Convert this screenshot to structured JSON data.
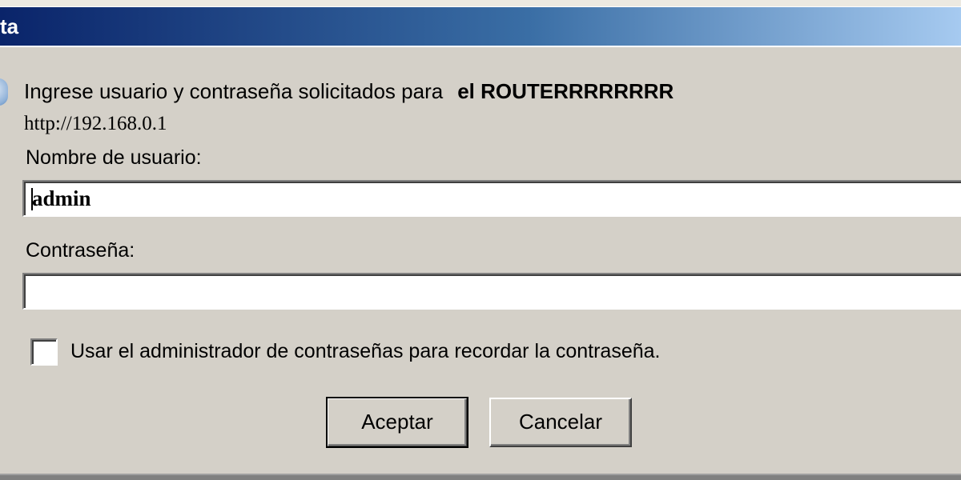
{
  "window": {
    "title": "ta"
  },
  "prompt": {
    "text": "Ingrese usuario y contraseña solicitados para",
    "realm": "el ROUTERRRRRRRR",
    "url": "http://192.168.0.1"
  },
  "username": {
    "label": "Nombre de usuario:",
    "value": "admin"
  },
  "password": {
    "label": "Contraseña:",
    "value": ""
  },
  "remember": {
    "label": "Usar el administrador de contraseñas para recordar la contraseña.",
    "checked": false
  },
  "buttons": {
    "ok_label": "Aceptar",
    "cancel_label": "Cancelar"
  },
  "colors": {
    "titlebar_start": "#0a246a",
    "titlebar_end": "#a6caf0",
    "dialog_bg": "#d4d0c8"
  },
  "icons": {
    "side_icon": "info-icon"
  }
}
